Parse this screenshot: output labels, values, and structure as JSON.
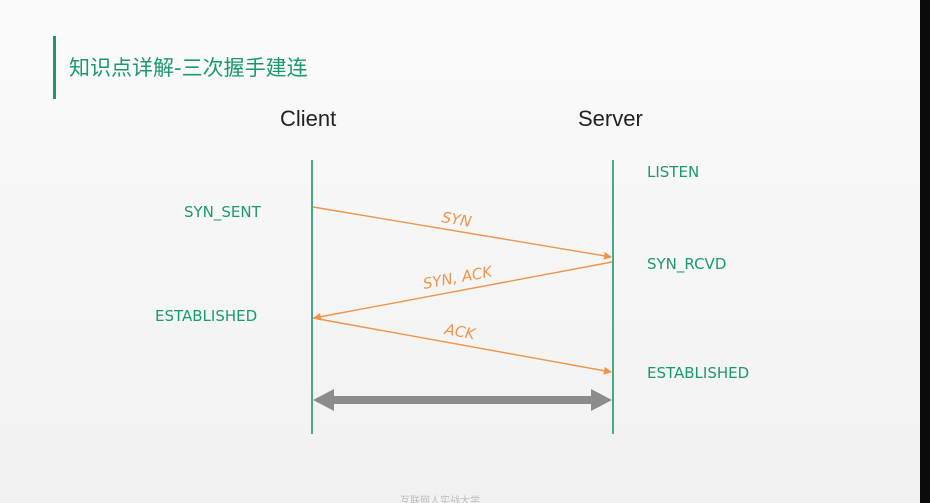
{
  "title": "知识点详解-三次握手建连",
  "actors": {
    "client": "Client",
    "server": "Server"
  },
  "states": {
    "server_listen": "LISTEN",
    "client_syn_sent": "SYN_SENT",
    "server_syn_rcvd": "SYN_RCVD",
    "client_established": "ESTABLISHED",
    "server_established": "ESTABLISHED"
  },
  "messages": [
    {
      "label": "SYN",
      "from": "client",
      "to": "server"
    },
    {
      "label": "SYN, ACK",
      "from": "server",
      "to": "client"
    },
    {
      "label": "ACK",
      "from": "client",
      "to": "server"
    }
  ],
  "footer": "互联网人实战大学",
  "colors": {
    "accent": "#1a9a6c",
    "message": "#f0944a",
    "connection": "#8c8c8c"
  }
}
